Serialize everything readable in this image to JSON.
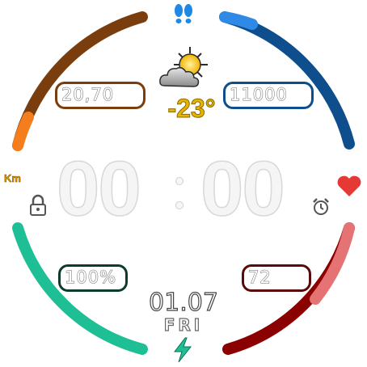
{
  "weather": {
    "temperature": "-23°",
    "icon": "partly-cloudy-icon"
  },
  "distance": {
    "unit": "Km",
    "value": "20,70"
  },
  "steps": {
    "value": "11000",
    "icon": "footsteps-icon"
  },
  "battery": {
    "value": "100%",
    "icon": "lightning-icon"
  },
  "heart_rate": {
    "value": "72",
    "icon": "heart-icon"
  },
  "time": {
    "hours": "00",
    "separator": ":",
    "minutes": "00"
  },
  "date": {
    "day_month": "01.07",
    "weekday": "FRI"
  },
  "colors": {
    "distance_arc": "#7a3e0e",
    "distance_accent": "#f47d1e",
    "steps_arc": "#0e4e8c",
    "steps_accent": "#2e8ae6",
    "battery_arc": "#1fbf95",
    "heart_arc": "#8b0000",
    "heart_accent": "#e57373",
    "temperature": "#e8b400",
    "icons": "#1e88e5",
    "heart": "#e53935"
  }
}
